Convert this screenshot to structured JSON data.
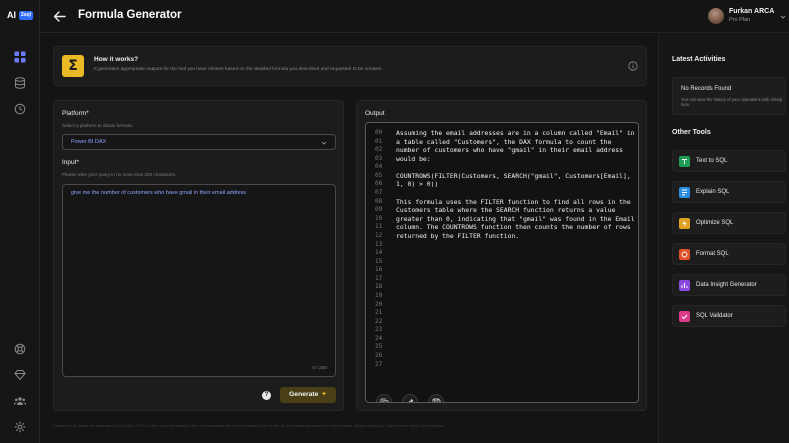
{
  "app": {
    "logo_text": "AI",
    "logo_badge": "2sql"
  },
  "header": {
    "title": "Formula Generator",
    "user_name": "Furkan ARCA",
    "user_plan": "Pro Plan"
  },
  "how_it_works": {
    "title": "How it works?",
    "description": "It generates appropriate outputs for the tool you have chosen based on the detailed formula you described and requested to be created."
  },
  "input_panel": {
    "platform_label": "Platform*",
    "platform_sub": "Select a platform to obtain formula.",
    "platform_value": "Power BI DAX",
    "input_label": "Input*",
    "input_sub": "Please write your query in no more than 200 characters.",
    "input_value": "give me the number of customers who have gmail in their email address",
    "char_count": "0 / 200",
    "help_label": "?",
    "generate_label": "Generate",
    "generate_icon": "sparkle-icon"
  },
  "output_panel": {
    "label": "Output",
    "line_numbers": [
      "00",
      "01",
      "02",
      "03",
      "04",
      "05",
      "06",
      "07",
      "08",
      "09",
      "10",
      "11",
      "12",
      "13",
      "14",
      "15",
      "16",
      "17",
      "18",
      "19",
      "20",
      "21",
      "22",
      "23",
      "24",
      "25",
      "26",
      "27"
    ],
    "code_lines": [
      "Assuming the email addresses are in a column called \"Email\" in",
      "a table called \"Customers\", the DAX formula to count the",
      "number of customers who have \"gmail\" in their email address",
      "would be:",
      "",
      "COUNTROWS(FILTER(Customers, SEARCH(\"gmail\", Customers[Email],",
      "1, 0) > 0))",
      "",
      "This formula uses the FILTER function to find all rows in the",
      "Customers table where the SEARCH function returns a value",
      "greater than 0, indicating that \"gmail\" was found in the Email",
      "column. The COUNTROWS function then counts the number of rows",
      "returned by the FILTER function."
    ]
  },
  "footer_note": "Disclaimer: AI results are generated by OpenAI's GPT-4. Other tools and data you see are transmitted into their interfaces in the model. All information generated for these content. Please verify your output before using it in production.",
  "right_panel": {
    "activities_heading": "Latest Activities",
    "empty_title": "No Records Found",
    "empty_desc": "You can view the history of your operations with AI2sql here.",
    "tools_heading": "Other Tools",
    "tools": [
      {
        "label": "Text to SQL",
        "color": "#1f9d57"
      },
      {
        "label": "Explain SQL",
        "color": "#2a8de0"
      },
      {
        "label": "Optimize SQL",
        "color": "#e0a11f"
      },
      {
        "label": "Format SQL",
        "color": "#e0512a"
      },
      {
        "label": "Data Insight Generator",
        "color": "#8a4ae0"
      },
      {
        "label": "SQL Validator",
        "color": "#d93a8a"
      }
    ]
  }
}
